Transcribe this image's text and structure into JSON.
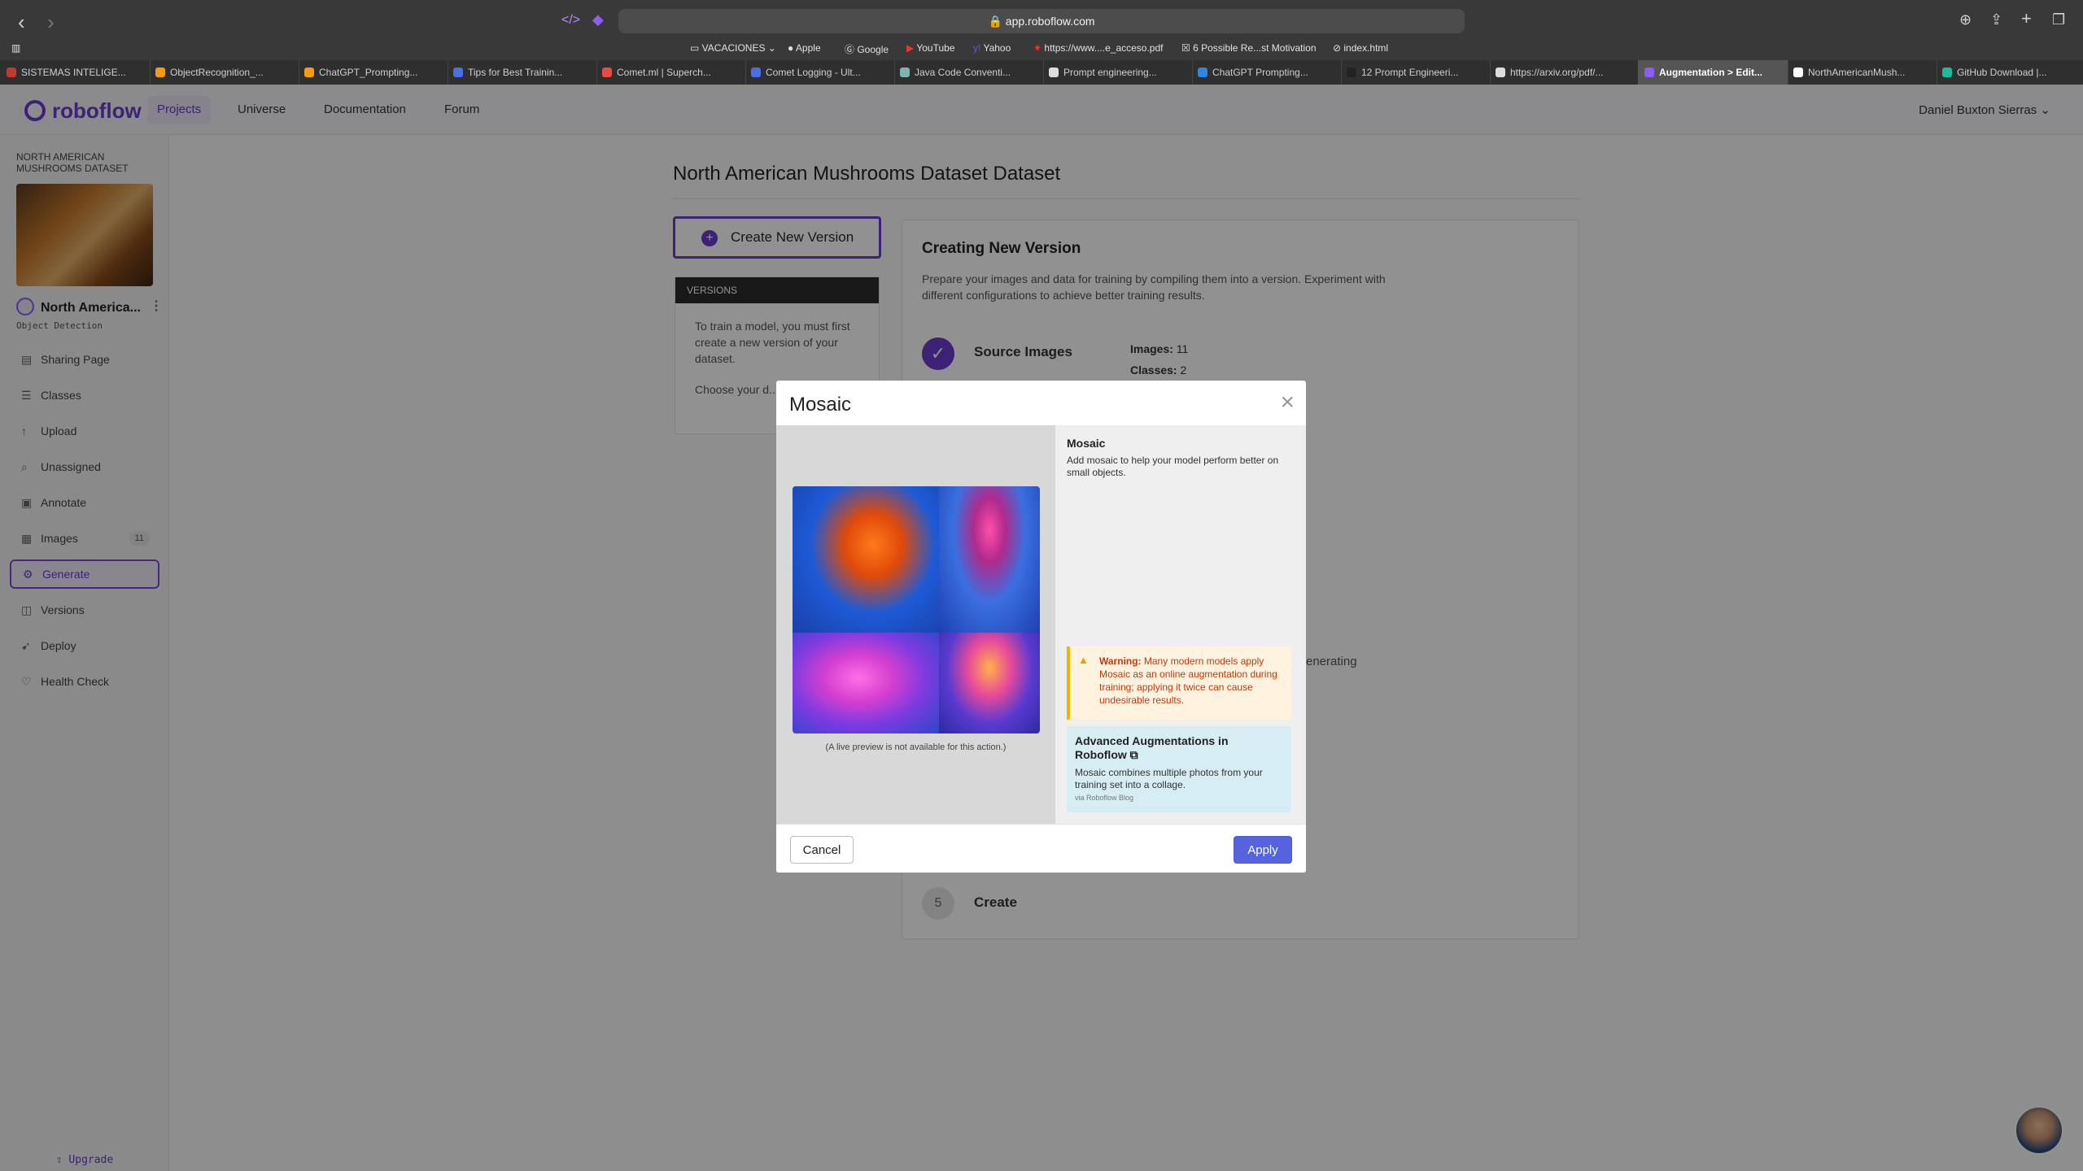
{
  "browser": {
    "url": "app.roboflow.com",
    "bookmarks": [
      "VACACIONES",
      "Apple",
      "Google",
      "YouTube",
      "Yahoo",
      "https://www....e_acceso.pdf",
      "6 Possible Re...st Motivation",
      "index.html"
    ],
    "tabs": [
      {
        "label": "SISTEMAS INTELIGE...",
        "color": "#c0392b"
      },
      {
        "label": "ObjectRecognition_...",
        "color": "#f39c12"
      },
      {
        "label": "ChatGPT_Prompting...",
        "color": "#f39c12"
      },
      {
        "label": "Tips for Best Trainin...",
        "color": "#4a6fe3"
      },
      {
        "label": "Comet.ml | Superch...",
        "color": "#e74c3c"
      },
      {
        "label": "Comet Logging - Ult...",
        "color": "#4a6fe3"
      },
      {
        "label": "Java Code Conventi...",
        "color": "#7fb3b0"
      },
      {
        "label": "Prompt engineering...",
        "color": "#dddddd"
      },
      {
        "label": "ChatGPT Prompting...",
        "color": "#2e86de"
      },
      {
        "label": "12 Prompt Engineeri...",
        "color": "#222222"
      },
      {
        "label": "https://arxiv.org/pdf/...",
        "color": "#dddddd"
      },
      {
        "label": "Augmentation > Edit...",
        "color": "#8b5cf6"
      },
      {
        "label": "NorthAmericanMush...",
        "color": "#ffffff"
      },
      {
        "label": "GitHub Download |...",
        "color": "#1abc9c"
      }
    ]
  },
  "header": {
    "brand": "roboflow",
    "nav": [
      "Projects",
      "Universe",
      "Documentation",
      "Forum"
    ],
    "user": "Daniel Buxton Sierras"
  },
  "sidebar": {
    "project_caption": "NORTH AMERICAN MUSHROOMS DATASET",
    "project_name": "North America...",
    "project_type": "Object Detection",
    "items": [
      {
        "label": "Sharing Page",
        "icon": "sharing-icon"
      },
      {
        "label": "Classes",
        "icon": "list-icon"
      },
      {
        "label": "Upload",
        "icon": "upload-icon"
      },
      {
        "label": "Unassigned",
        "icon": "search-icon"
      },
      {
        "label": "Annotate",
        "icon": "annotate-icon"
      },
      {
        "label": "Images",
        "icon": "image-icon",
        "count": "11"
      },
      {
        "label": "Generate",
        "icon": "generate-icon"
      },
      {
        "label": "Versions",
        "icon": "versions-icon"
      },
      {
        "label": "Deploy",
        "icon": "deploy-icon"
      },
      {
        "label": "Health Check",
        "icon": "health-icon"
      }
    ],
    "upgrade": "Upgrade"
  },
  "main": {
    "title": "North American Mushrooms Dataset Dataset",
    "create_button": "Create New Version",
    "versions_header": "VERSIONS",
    "versions_text_1": "To train a model, you must first create a new version of your dataset.",
    "versions_text_2": "Choose your d... to get started.",
    "panel_title": "Creating New Version",
    "panel_desc": "Prepare your images and data for training by compiling them into a version. Experiment with different configurations to achieve better training results.",
    "step_source": "Source Images",
    "images_label": "Images:",
    "images_value": "11",
    "classes_label": "Classes:",
    "classes_value": "2",
    "generating_text": "enerating",
    "step5_num": "5",
    "step5_label": "Create"
  },
  "modal": {
    "title": "Mosaic",
    "preview_note": "(A live preview is not available for this action.)",
    "info_title": "Mosaic",
    "info_desc": "Add mosaic to help your model perform better on small objects.",
    "warning_label": "Warning:",
    "warning_text": "Many modern models apply Mosaic as an online augmentation during training; applying it twice can cause undesirable results.",
    "adv_title": "Advanced Augmentations in Roboflow",
    "adv_desc": "Mosaic combines multiple photos from your training set into a collage.",
    "adv_source": "via Roboflow Blog",
    "cancel": "Cancel",
    "apply": "Apply"
  },
  "colors": {
    "accent": "#6b3ad1",
    "apply": "#5563dc"
  }
}
